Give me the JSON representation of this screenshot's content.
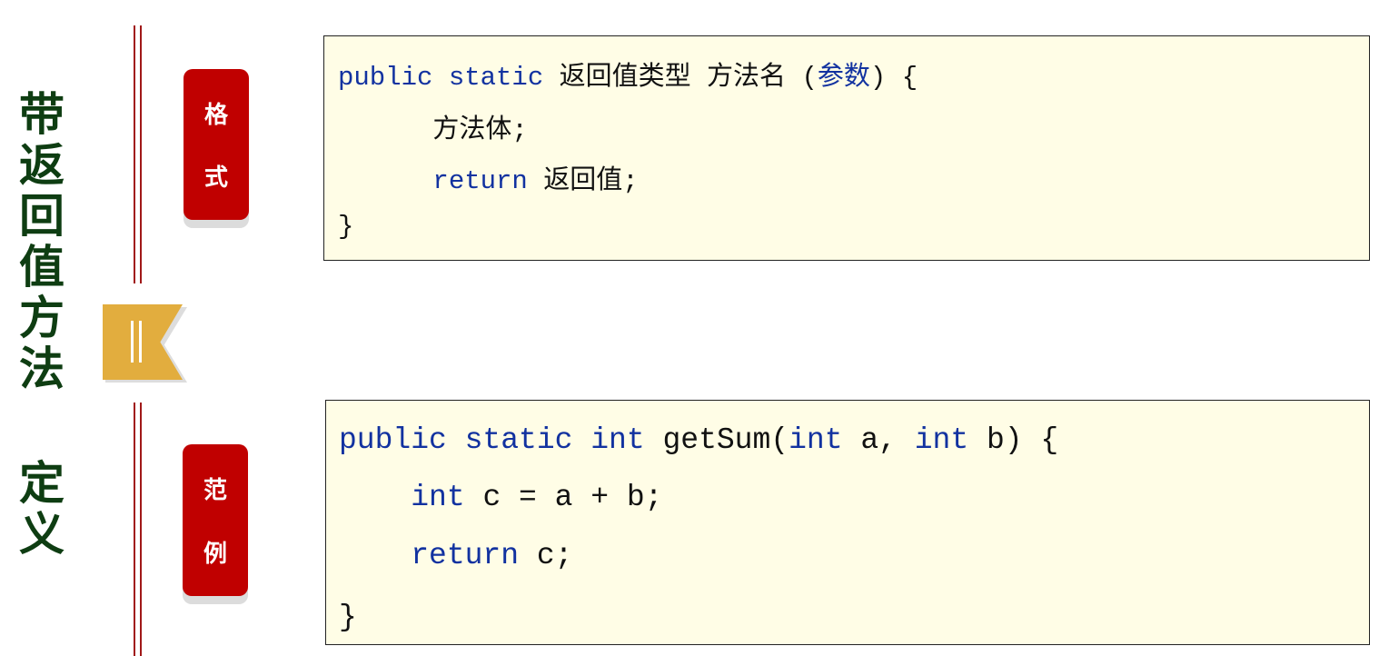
{
  "title": {
    "line1": [
      "带",
      "返",
      "回",
      "值",
      "方",
      "法"
    ],
    "line2": [
      "定",
      "义"
    ]
  },
  "badges": {
    "format": [
      "格",
      "式"
    ],
    "example": [
      "范",
      "例"
    ]
  },
  "colors": {
    "title": "#0e3d12",
    "badge": "#c00000",
    "ribbon": "#e2ad3e",
    "keyword": "#1232a0",
    "code_bg": "#fffde6"
  },
  "format_code": [
    [
      {
        "t": "public static",
        "kw": true
      },
      {
        "t": " 返回值类型 方法名 ("
      },
      {
        "t": "参数",
        "kw": true
      },
      {
        "t": ") {"
      }
    ],
    [
      {
        "t": "      方法体;"
      }
    ],
    [
      {
        "t": "      "
      },
      {
        "t": "return",
        "kw": true
      },
      {
        "t": " 返回值;"
      }
    ],
    [
      {
        "t": "}"
      }
    ]
  ],
  "example_code": [
    [
      {
        "t": "public static int",
        "kw": true
      },
      {
        "t": " getSum("
      },
      {
        "t": "int",
        "kw": true
      },
      {
        "t": " a, "
      },
      {
        "t": "int",
        "kw": true
      },
      {
        "t": " b) {"
      }
    ],
    [
      {
        "t": "    "
      },
      {
        "t": "int",
        "kw": true
      },
      {
        "t": " c = a + b;"
      }
    ],
    [
      {
        "t": "    "
      },
      {
        "t": "return",
        "kw": true
      },
      {
        "t": " c;"
      }
    ],
    [
      {
        "t": "}"
      }
    ]
  ]
}
